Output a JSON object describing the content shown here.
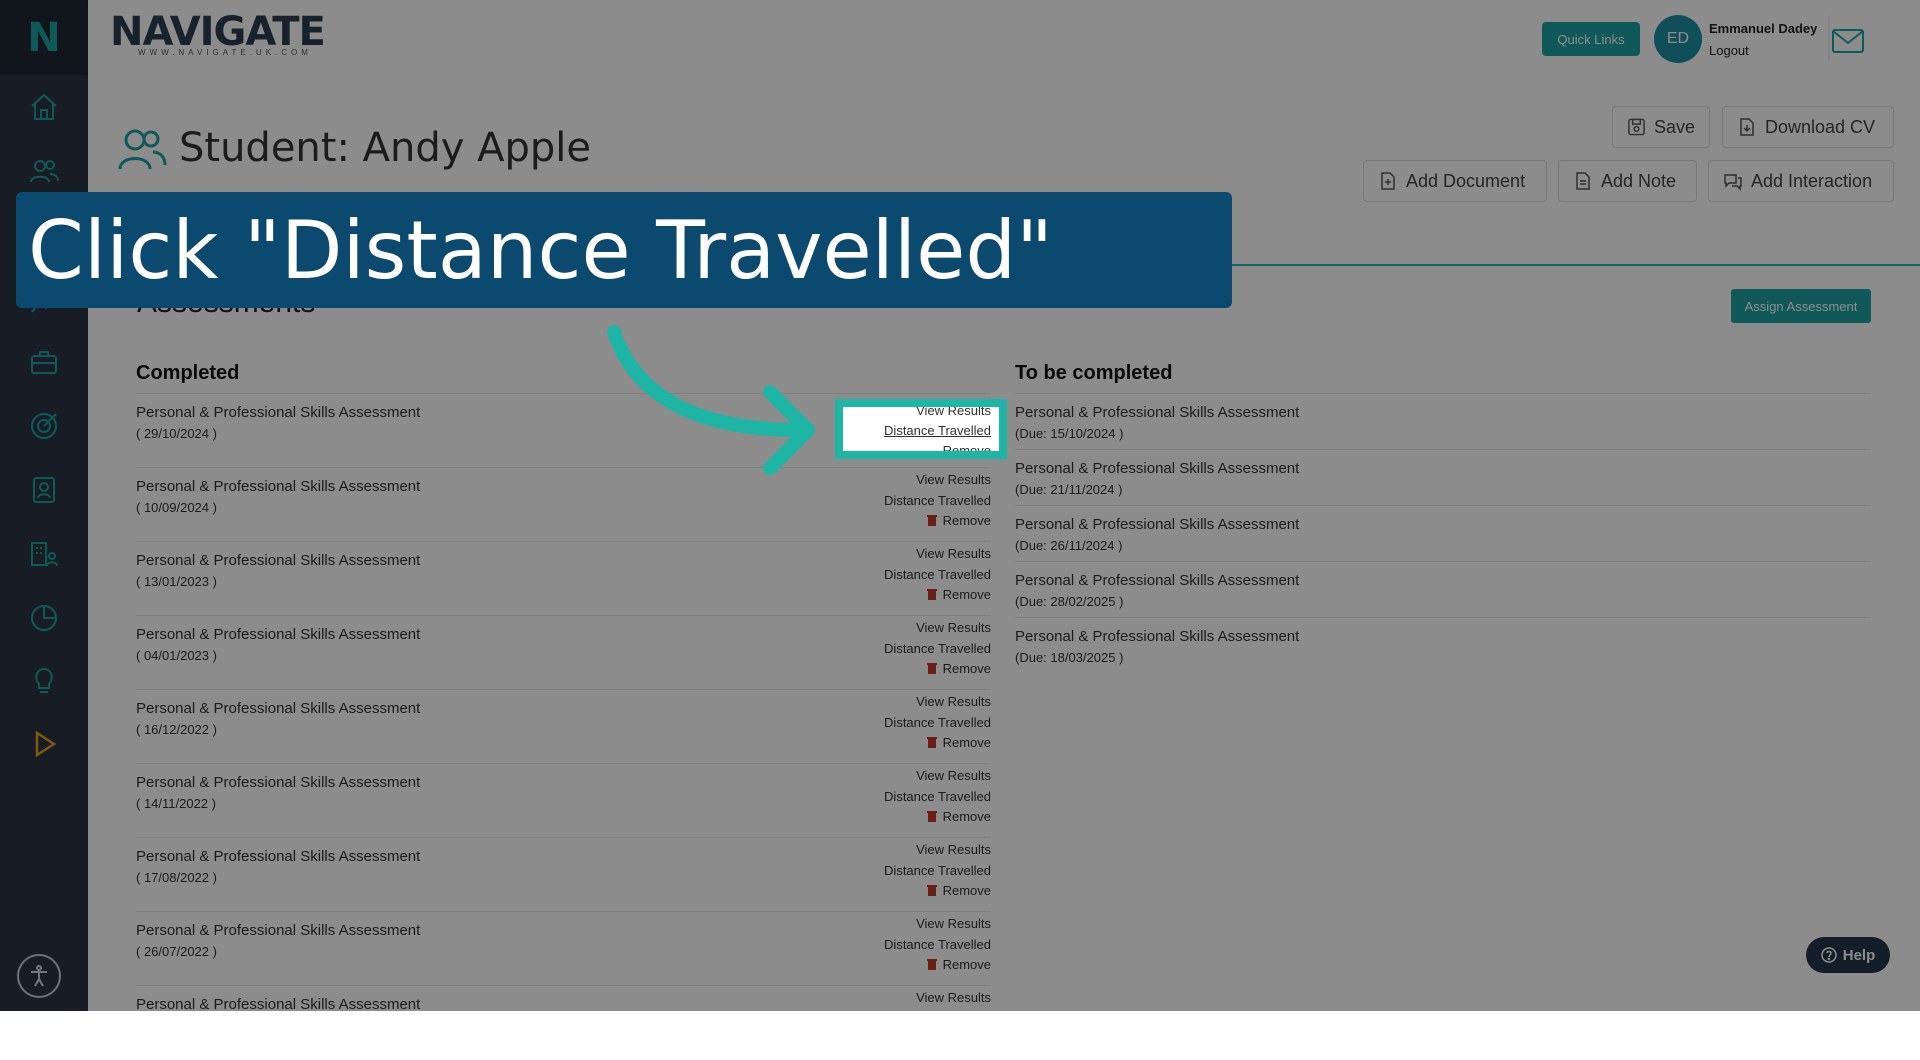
{
  "brand": {
    "name": "NAVIGATE",
    "url": "WWW.NAVIGATE.UK.COM"
  },
  "sidebar": {
    "logo": "N",
    "icons": [
      "home-icon",
      "users-icon",
      "chart-icon",
      "briefcase-icon",
      "target-icon",
      "contact-card-icon",
      "building-people-icon",
      "pie-chart-icon",
      "lightbulb-icon",
      "play-icon"
    ],
    "accessibility": "accessibility-icon"
  },
  "header": {
    "quick_links": "Quick Links",
    "avatar_initials": "ED",
    "user_name": "Emmanuel Dadey",
    "logout": "Logout"
  },
  "page": {
    "title": "Student: Andy Apple",
    "buttons": {
      "save": "Save",
      "download_cv": "Download CV",
      "add_document": "Add Document",
      "add_note": "Add Note",
      "add_interaction": "Add Interaction"
    },
    "section_title": "Assessments",
    "assign_button": "Assign Assessment"
  },
  "completed": {
    "heading": "Completed",
    "actions": {
      "view": "View Results",
      "distance": "Distance Travelled",
      "remove": "Remove"
    },
    "rows": [
      {
        "name": "Personal & Professional Skills Assessment",
        "date": "( 29/10/2024 )"
      },
      {
        "name": "Personal & Professional Skills Assessment",
        "date": "( 10/09/2024 )"
      },
      {
        "name": "Personal & Professional Skills Assessment",
        "date": "( 13/01/2023 )"
      },
      {
        "name": "Personal & Professional Skills Assessment",
        "date": "( 04/01/2023 )"
      },
      {
        "name": "Personal & Professional Skills Assessment",
        "date": "( 16/12/2022 )"
      },
      {
        "name": "Personal & Professional Skills Assessment",
        "date": "( 14/11/2022 )"
      },
      {
        "name": "Personal & Professional Skills Assessment",
        "date": "( 17/08/2022 )"
      },
      {
        "name": "Personal & Professional Skills Assessment",
        "date": "( 26/07/2022 )"
      },
      {
        "name": "Personal & Professional Skills Assessment",
        "date": ""
      }
    ]
  },
  "to_be_completed": {
    "heading": "To be completed",
    "rows": [
      {
        "name": "Personal & Professional Skills Assessment",
        "due": "(Due: 15/10/2024 )"
      },
      {
        "name": "Personal & Professional Skills Assessment",
        "due": "(Due: 21/11/2024 )"
      },
      {
        "name": "Personal & Professional Skills Assessment",
        "due": "(Due: 26/11/2024 )"
      },
      {
        "name": "Personal & Professional Skills Assessment",
        "due": "(Due: 28/02/2025 )"
      },
      {
        "name": "Personal & Professional Skills Assessment",
        "due": "(Due: 18/03/2025 )"
      }
    ]
  },
  "help": "Help",
  "tutorial": {
    "instruction": "Click \"Distance Travelled\""
  },
  "colors": {
    "accent": "#1fa3a0",
    "sidebar": "#2a3444",
    "banner": "#0b4a6e",
    "highlight": "#1fb5a5"
  }
}
